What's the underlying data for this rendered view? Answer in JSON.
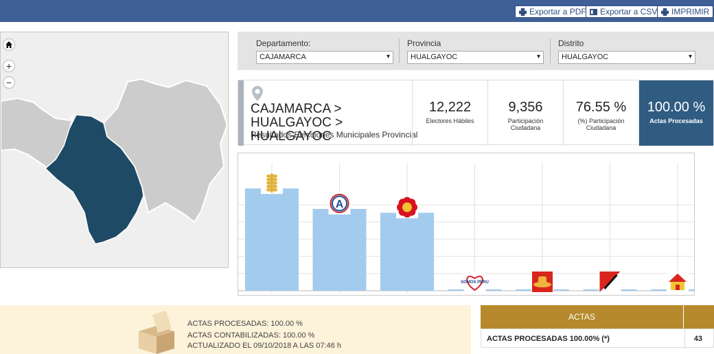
{
  "toolbar": {
    "export_pdf": "Exportar a PDF",
    "export_csv": "Exportar a CSV",
    "print": "IMPRIMIR"
  },
  "map": {
    "home_icon": "home-icon",
    "zoom_in": "+",
    "zoom_out": "−",
    "highlight_color": "#1f4a66",
    "base_color": "#cccccc"
  },
  "filters": {
    "departamento": {
      "label": "Departamento:",
      "value": "CAJAMARCA"
    },
    "provincia": {
      "label": "Provincia",
      "value": "HUALGAYOC"
    },
    "distrito": {
      "label": "Distrito",
      "value": "HUALGAYOC"
    }
  },
  "location": {
    "title": "CAJAMARCA > HUALGAYOC > HUALGAYOC",
    "subtitle": "Resultados Elecciones Municipales Provincial"
  },
  "stats": [
    {
      "value": "12,222",
      "label": "Electores Hábiles"
    },
    {
      "value": "9,356",
      "label": "Participación Ciudadana"
    },
    {
      "value": "76.55 %",
      "label": "(%) Participación Ciudadana"
    },
    {
      "value": "100.00 %",
      "label": "Actas Procesadas"
    }
  ],
  "chart_data": {
    "type": "bar",
    "categories": [
      "party-1",
      "party-2",
      "party-3",
      "party-4",
      "party-5",
      "party-6",
      "party-7"
    ],
    "values": [
      0.8,
      0.64,
      0.61,
      0.01,
      0.01,
      0.01,
      0.01
    ],
    "party_icons": [
      "wheat-icon",
      "letter-a-icon",
      "red-flower-icon",
      "somos-peru-heart-icon",
      "hat-icon",
      "shovel-icon",
      "house-icon"
    ],
    "somos_peru_text": "SOMOS PERU",
    "bar_color": "#a3cbed",
    "grid": true
  },
  "summary": {
    "actas_procesadas": "ACTAS PROCESADAS: 100.00 %",
    "actas_contabilizadas": "ACTAS CONTABILIZADAS: 100.00 %",
    "actualizado": "ACTUALIZADO EL 09/10/2018 A LAS 07:46 h"
  },
  "actas_table": {
    "header": "ACTAS",
    "rows": [
      {
        "label": "ACTAS PROCESADAS 100.00% (*)",
        "value": "43"
      }
    ]
  }
}
